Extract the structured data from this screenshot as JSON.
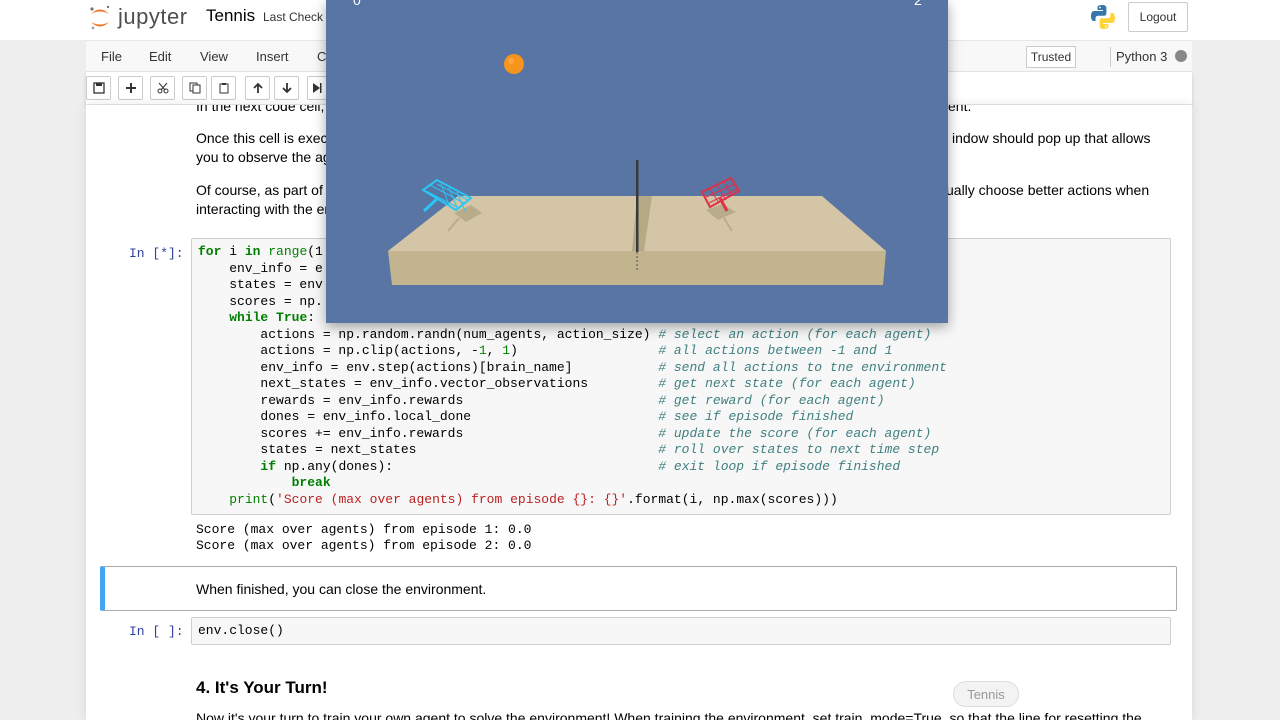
{
  "header": {
    "logo_text": "jupyter",
    "notebook_title": "Tennis",
    "checkpoint_text": "Last Check",
    "logout_label": "Logout"
  },
  "menubar": {
    "items": [
      "File",
      "Edit",
      "View",
      "Insert",
      "C"
    ],
    "trusted_label": "Trusted",
    "kernel_name": "Python 3"
  },
  "toolbar": {
    "buttons": [
      "save-icon",
      "plus-icon",
      "cut-icon",
      "copy-icon",
      "paste-icon",
      "arrow-up-icon",
      "arrow-down-icon",
      "run-icon"
    ]
  },
  "markdown": {
    "line_top_left": "In the next code cell,",
    "line_top_right": "ent.",
    "p1_line1_left": "Once this cell is execu",
    "p1_line1_right": "indow should pop up that allows",
    "p1_line2_left": "you to observe the ag",
    "p2_line1_left": "Of course, as part of t",
    "p2_line1_right": "ually choose better actions when",
    "p2_line2_left": "interacting with the en"
  },
  "code_cell_1": {
    "prompt": "In [*]:",
    "output_lines": [
      "Score (max over agents) from episode 1: 0.0",
      "Score (max over agents) from episode 2: 0.0"
    ]
  },
  "markdown_2": {
    "text": "When finished, you can close the environment."
  },
  "code_cell_2": {
    "prompt": "In [ ]:",
    "code": "env.close()"
  },
  "section": {
    "heading": "4. It's Your Turn!",
    "text_partial": "Now it's your turn to train your own agent to solve the environment! When training the environment, set train_mode=True, so that the line for resetting the"
  },
  "game_window": {
    "score_left": "0",
    "score_right": "2"
  },
  "tooltip": {
    "text": "Tennis"
  },
  "colors": {
    "selected_cell_border": "#42a5f5",
    "game_background": "#5975a3",
    "ball": "#f7941d",
    "racket_left": "#29c5f6",
    "racket_right": "#e0314b"
  }
}
